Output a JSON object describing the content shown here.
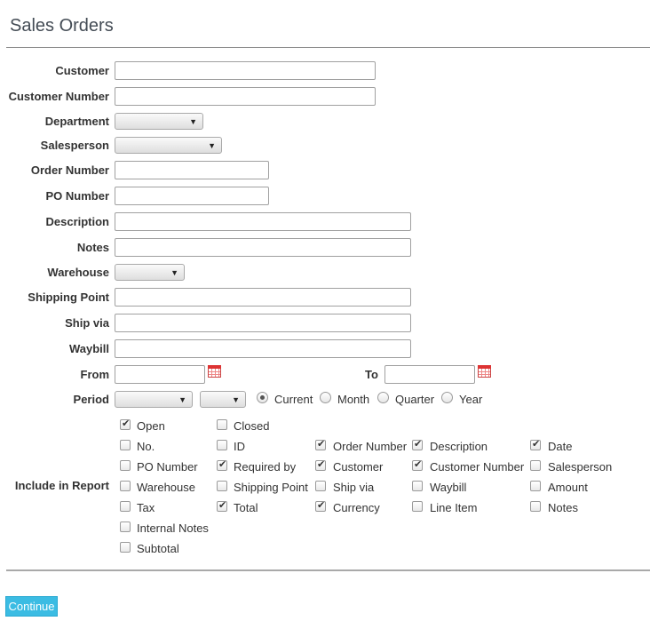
{
  "page": {
    "title": "Sales Orders"
  },
  "fields": {
    "customer": {
      "label": "Customer",
      "value": ""
    },
    "customer_number": {
      "label": "Customer Number",
      "value": ""
    },
    "department": {
      "label": "Department",
      "value": ""
    },
    "salesperson": {
      "label": "Salesperson",
      "value": ""
    },
    "order_number": {
      "label": "Order Number",
      "value": ""
    },
    "po_number": {
      "label": "PO Number",
      "value": ""
    },
    "description": {
      "label": "Description",
      "value": ""
    },
    "notes": {
      "label": "Notes",
      "value": ""
    },
    "warehouse": {
      "label": "Warehouse",
      "value": ""
    },
    "shipping_point": {
      "label": "Shipping Point",
      "value": ""
    },
    "ship_via": {
      "label": "Ship via",
      "value": ""
    },
    "waybill": {
      "label": "Waybill",
      "value": ""
    },
    "from": {
      "label": "From",
      "value": ""
    },
    "to": {
      "label": "To",
      "value": ""
    }
  },
  "period": {
    "label": "Period",
    "month_value": "",
    "year_value": "",
    "options": [
      {
        "label": "Current",
        "selected": true
      },
      {
        "label": "Month",
        "selected": false
      },
      {
        "label": "Quarter",
        "selected": false
      },
      {
        "label": "Year",
        "selected": false
      }
    ]
  },
  "include": {
    "label": "Include in Report",
    "items": [
      {
        "label": "Open",
        "checked": true
      },
      {
        "label": "Closed",
        "checked": false
      },
      {
        "label": "No.",
        "checked": false
      },
      {
        "label": "ID",
        "checked": false
      },
      {
        "label": "Order Number",
        "checked": true
      },
      {
        "label": "Description",
        "checked": true
      },
      {
        "label": "Date",
        "checked": true
      },
      {
        "label": "PO Number",
        "checked": false
      },
      {
        "label": "Required by",
        "checked": true
      },
      {
        "label": "Customer",
        "checked": true
      },
      {
        "label": "Customer Number",
        "checked": true
      },
      {
        "label": "Salesperson",
        "checked": false
      },
      {
        "label": "Warehouse",
        "checked": false
      },
      {
        "label": "Shipping Point",
        "checked": false
      },
      {
        "label": "Ship via",
        "checked": false
      },
      {
        "label": "Waybill",
        "checked": false
      },
      {
        "label": "Amount",
        "checked": false
      },
      {
        "label": "Tax",
        "checked": false
      },
      {
        "label": "Total",
        "checked": true
      },
      {
        "label": "Currency",
        "checked": true
      },
      {
        "label": "Line Item",
        "checked": false
      },
      {
        "label": "Notes",
        "checked": false
      },
      {
        "label": "Internal Notes",
        "checked": false
      },
      {
        "label": "Subtotal",
        "checked": false
      }
    ]
  },
  "actions": {
    "continue_label": "Continue"
  }
}
